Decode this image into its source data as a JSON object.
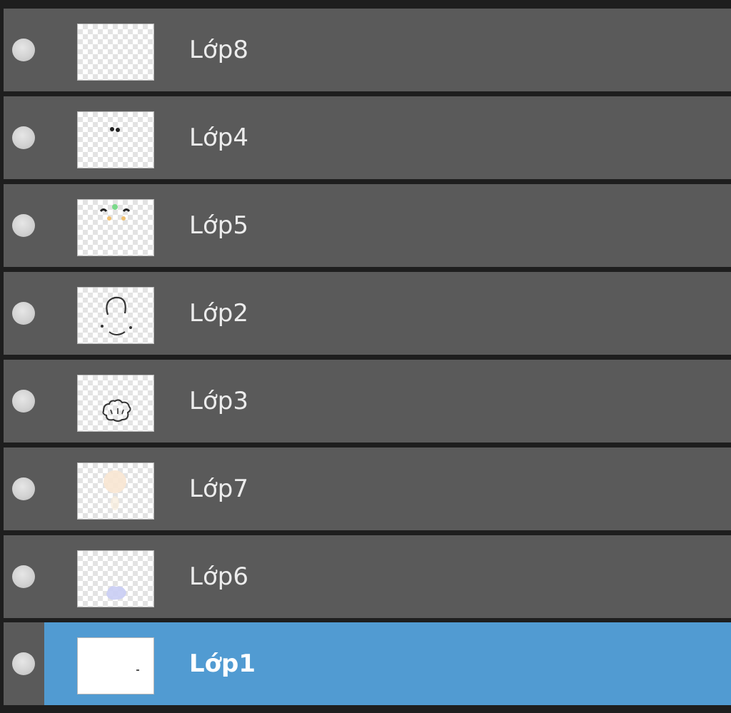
{
  "layers_panel": {
    "layers": [
      {
        "name": "Lớp8",
        "thumbnail": "empty-transparent",
        "visible": true,
        "selected": false
      },
      {
        "name": "Lớp4",
        "thumbnail": "eyes-sketch",
        "visible": true,
        "selected": false
      },
      {
        "name": "Lớp5",
        "thumbnail": "hair-bow-sketch",
        "visible": true,
        "selected": false
      },
      {
        "name": "Lớp2",
        "thumbnail": "head-outline-sketch",
        "visible": true,
        "selected": false
      },
      {
        "name": "Lớp3",
        "thumbnail": "paw-outline-sketch",
        "visible": true,
        "selected": false
      },
      {
        "name": "Lớp7",
        "thumbnail": "skin-color-fill",
        "visible": true,
        "selected": false
      },
      {
        "name": "Lớp6",
        "thumbnail": "blue-color-fill",
        "visible": true,
        "selected": false
      },
      {
        "name": "Lớp1",
        "thumbnail": "white-background",
        "visible": true,
        "selected": true
      }
    ]
  },
  "colors": {
    "row_background": "#5a5a5a",
    "selected_background": "#519bd2",
    "panel_background": "#1e1e1e",
    "text": "#ececec"
  }
}
